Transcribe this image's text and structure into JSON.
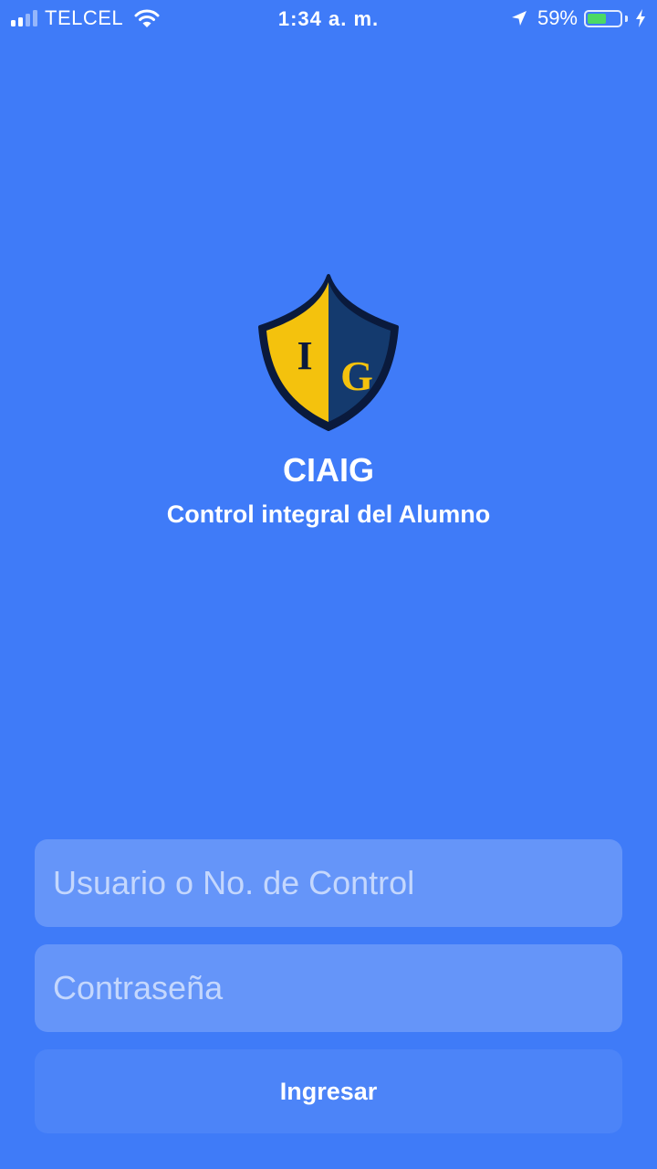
{
  "status_bar": {
    "carrier": "TELCEL",
    "time": "1:34 a. m.",
    "battery_percent": "59%",
    "battery_level": 0.59,
    "icons": [
      "signal-icon",
      "wifi-icon",
      "location-arrow-icon",
      "battery-icon",
      "charging-bolt-icon"
    ]
  },
  "brand": {
    "logo_letters": "IG",
    "title": "CIAIG",
    "subtitle": "Control integral del Alumno"
  },
  "login_form": {
    "username_placeholder": "Usuario o No. de Control",
    "username_value": "",
    "password_placeholder": "Contraseña",
    "password_value": "",
    "submit_label": "Ingresar"
  },
  "colors": {
    "background": "#3f7bf8",
    "crest_gold": "#f4c20d",
    "crest_navy": "#143a6e",
    "battery_green": "#4cd964"
  }
}
